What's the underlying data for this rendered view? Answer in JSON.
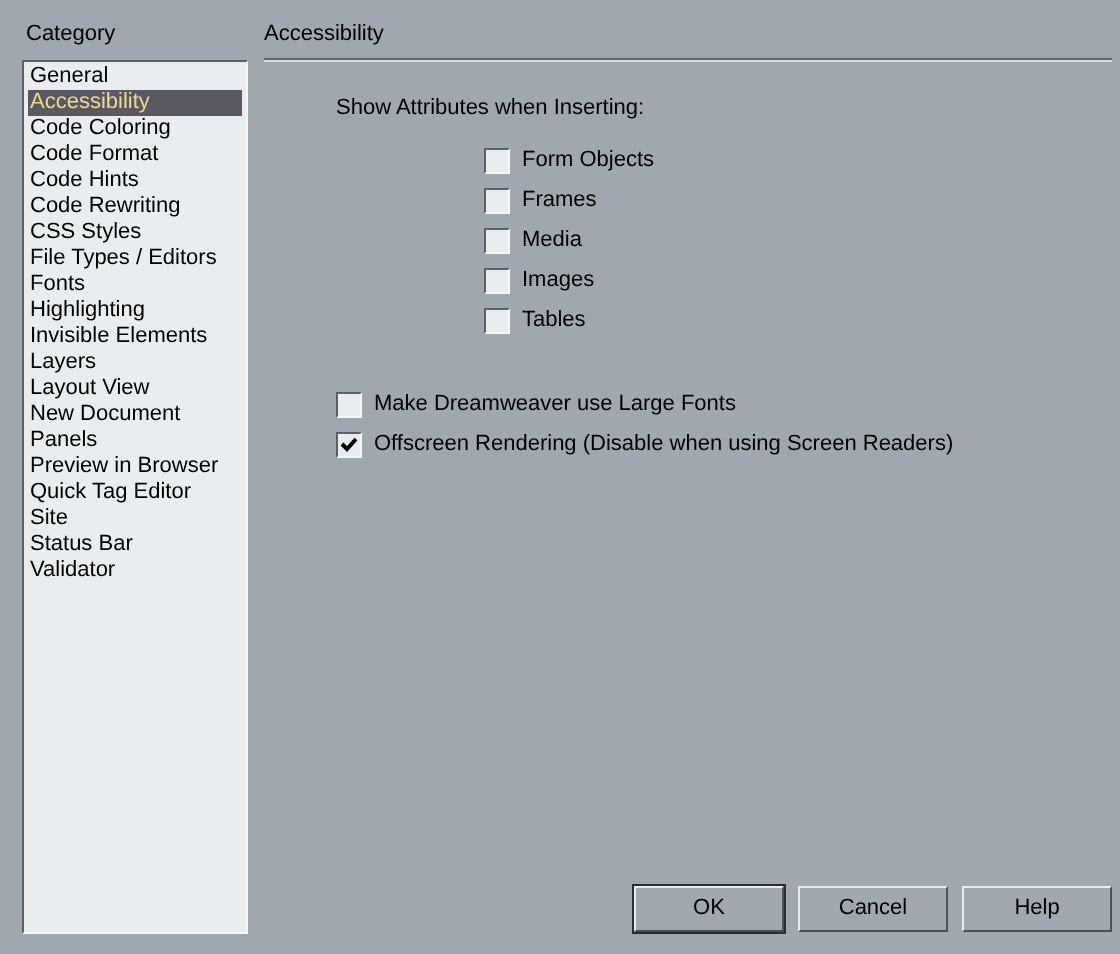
{
  "category_header": "Category",
  "categories": [
    {
      "label": "General",
      "selected": false
    },
    {
      "label": "Accessibility",
      "selected": true
    },
    {
      "label": "Code Coloring",
      "selected": false
    },
    {
      "label": "Code Format",
      "selected": false
    },
    {
      "label": "Code Hints",
      "selected": false
    },
    {
      "label": "Code Rewriting",
      "selected": false
    },
    {
      "label": "CSS Styles",
      "selected": false
    },
    {
      "label": "File Types / Editors",
      "selected": false
    },
    {
      "label": "Fonts",
      "selected": false
    },
    {
      "label": "Highlighting",
      "selected": false
    },
    {
      "label": "Invisible Elements",
      "selected": false
    },
    {
      "label": "Layers",
      "selected": false
    },
    {
      "label": "Layout View",
      "selected": false
    },
    {
      "label": "New Document",
      "selected": false
    },
    {
      "label": "Panels",
      "selected": false
    },
    {
      "label": "Preview in Browser",
      "selected": false
    },
    {
      "label": "Quick Tag Editor",
      "selected": false
    },
    {
      "label": "Site",
      "selected": false
    },
    {
      "label": "Status Bar",
      "selected": false
    },
    {
      "label": "Validator",
      "selected": false
    }
  ],
  "panel_title": "Accessibility",
  "section_label": "Show Attributes when Inserting:",
  "attribute_options": [
    {
      "label": "Form Objects",
      "checked": false
    },
    {
      "label": "Frames",
      "checked": false
    },
    {
      "label": "Media",
      "checked": false
    },
    {
      "label": "Images",
      "checked": false
    },
    {
      "label": "Tables",
      "checked": false
    }
  ],
  "general_options": [
    {
      "label": "Make Dreamweaver use Large Fonts",
      "checked": false
    },
    {
      "label": "Offscreen Rendering (Disable when using Screen Readers)",
      "checked": true
    }
  ],
  "buttons": [
    {
      "label": "OK",
      "default": true
    },
    {
      "label": "Cancel",
      "default": false
    },
    {
      "label": "Help",
      "default": false
    }
  ]
}
